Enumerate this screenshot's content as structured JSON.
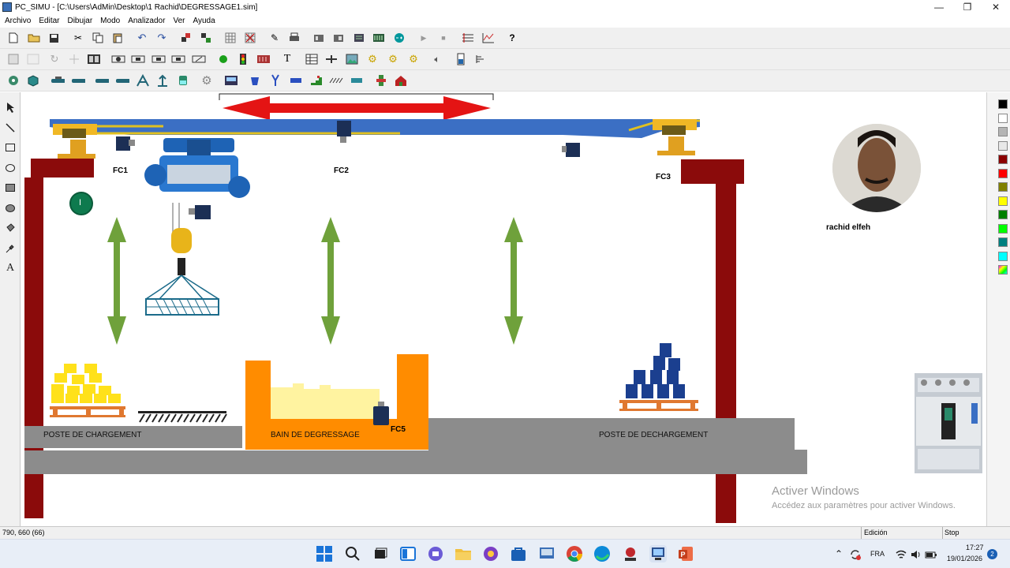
{
  "window": {
    "title": "PC_SIMU - [C:\\Users\\AdMin\\Desktop\\1 Rachid\\DEGRESSAGE1.sim]",
    "minimize": "—",
    "maximize": "❐",
    "close": "✕"
  },
  "menu": [
    "Archivo",
    "Editar",
    "Dibujar",
    "Modo",
    "Analizador",
    "Ver",
    "Ayuda"
  ],
  "toolbar_icons": {
    "row1": [
      "new-file-icon",
      "open-folder-icon",
      "save-icon",
      "cut-icon",
      "copy-icon",
      "paste-icon",
      "undo-icon",
      "redo-icon",
      "group-icon",
      "ungroup-icon",
      "grid-icon",
      "grid-snap-icon",
      "pencil-icon",
      "printer-icon",
      "module-icon",
      "module-icon",
      "module-icon",
      "module-icon",
      "arduino-icon",
      "play-icon",
      "stop-icon",
      "analyzer-icon",
      "chart-icon",
      "help-icon"
    ],
    "row2": [
      "device-icon",
      "device-icon",
      "rotate-icon",
      "crosshair-icon",
      "binary-icon",
      "sensor-icon",
      "sensor-icon",
      "sensor-icon",
      "sensor-icon",
      "sensor-icon",
      "lamp-icon",
      "traffic-light-icon",
      "display-icon",
      "text-icon",
      "table-icon",
      "valve-icon",
      "picture-icon",
      "gear-icon",
      "gear-icon",
      "gear-icon",
      "speaker-icon",
      "level-icon",
      "bargraph-icon"
    ],
    "row3": [
      "robot-icon",
      "box-icon",
      "conveyor-icon",
      "conveyor-icon",
      "conveyor-icon",
      "conveyor-icon",
      "crane-icon",
      "crane-icon",
      "tank-icon",
      "gear-cog-icon",
      "panel-icon",
      "bucket-icon",
      "pliers-icon",
      "bar-icon",
      "stairs-icon",
      "hatch-icon",
      "bar-icon",
      "cylinder-icon",
      "house-icon"
    ]
  },
  "left_tools": [
    "select-arrow-icon",
    "line-icon",
    "rectangle-icon",
    "ellipse-icon",
    "filled-rectangle-icon",
    "filled-ellipse-icon",
    "fill-bucket-icon",
    "eyedropper-icon",
    "text-tool-icon"
  ],
  "left_tools_text_glyph": "A",
  "palette": [
    "#000000",
    "#ffffff",
    "#b4b4b4",
    "#e8e8e8",
    "#8b0000",
    "#ff0000",
    "#808000",
    "#ffff00",
    "#008000",
    "#00ff00",
    "#008080",
    "#00ffff",
    "#ff00ff"
  ],
  "scene": {
    "sensors": {
      "fc1": "FC1",
      "fc2": "FC2",
      "fc3": "FC3",
      "fc5": "FC5"
    },
    "indicator_glyph": "I",
    "author_name": "rachid elfeh",
    "stations": {
      "loading": "POSTE DE CHARGEMENT",
      "bath": "BAIN DE DEGRESSAGE",
      "unloading": "POSTE DE DECHARGEMENT"
    },
    "colors": {
      "rail": "#3b6fc4",
      "rail_edge": "#e0c020",
      "pillar": "#8b0b0b",
      "arrow_red": "#e41414",
      "arrow_green": "#6fa13b",
      "floor": "#8c8c8c",
      "bath": "#ff8c00",
      "liquid": "#fff3a0",
      "gold": "#ffe11a",
      "blue_crates": "#1b3f8f",
      "pallet": "#e07830"
    }
  },
  "watermark": {
    "line1": "Activer Windows",
    "line2": "Accédez aux paramètres pour activer Windows."
  },
  "status": {
    "coords": "790, 660 (66)",
    "mode": "Edición",
    "state": "Stop"
  },
  "taskbar": {
    "lang": "FRA",
    "time": "17:27",
    "date": "19/01/2026",
    "notifications": "2"
  }
}
